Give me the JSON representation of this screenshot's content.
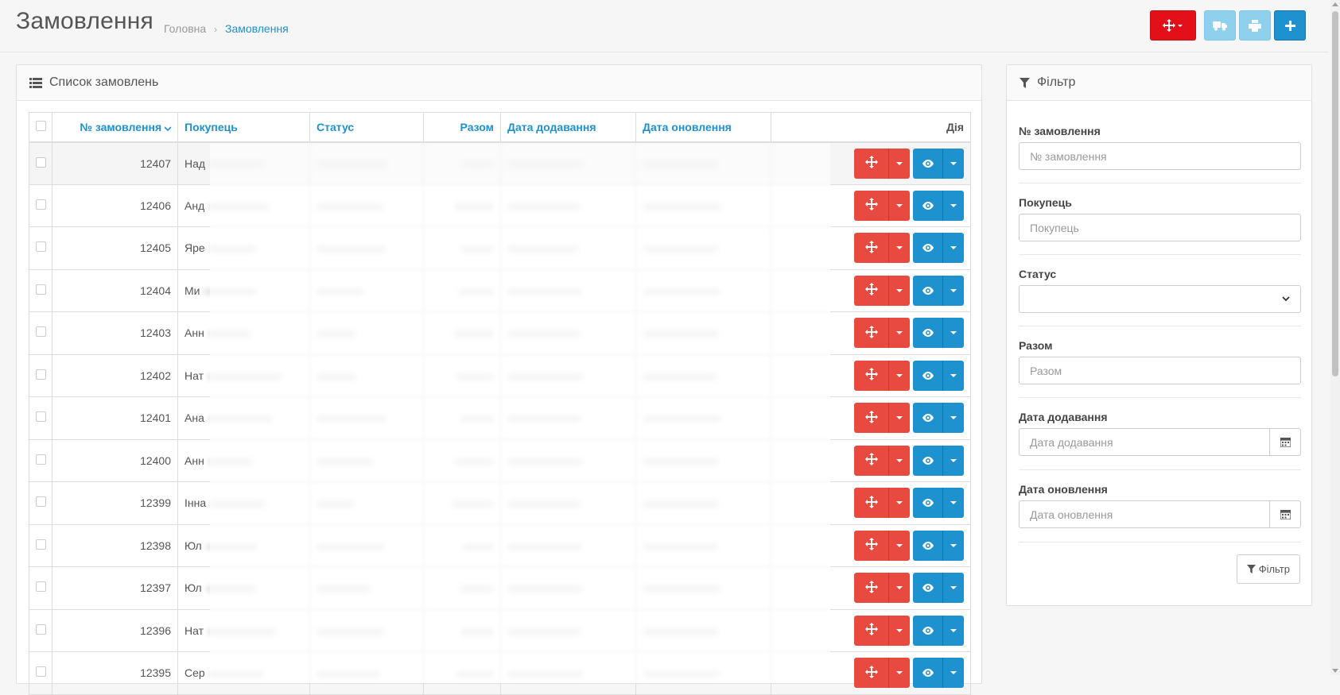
{
  "header": {
    "title": "Замовлення",
    "breadcrumb": [
      {
        "label": "Головна"
      },
      {
        "label": "Замовлення"
      }
    ],
    "buttons": [
      {
        "icon": "arrows-move-icon",
        "color": "#e3101a"
      },
      {
        "icon": "truck-icon",
        "color": "#8fd1ec"
      },
      {
        "icon": "print-icon",
        "color": "#8fd1ec"
      },
      {
        "icon": "plus-icon",
        "color": "#1e91cf"
      }
    ]
  },
  "orders_panel": {
    "title": "Список замовлень",
    "columns": {
      "order_id": "№ замовлення",
      "customer": "Покупець",
      "status": "Статус",
      "total": "Разом",
      "date_added": "Дата додавання",
      "date_modified": "Дата оновлення",
      "action": "Дія"
    },
    "rows": [
      {
        "order_id": "12407",
        "customer": "Над"
      },
      {
        "order_id": "12406",
        "customer": "Анд"
      },
      {
        "order_id": "12405",
        "customer": "Яре"
      },
      {
        "order_id": "12404",
        "customer": "Ми"
      },
      {
        "order_id": "12403",
        "customer": "Анн"
      },
      {
        "order_id": "12402",
        "customer": "Нат"
      },
      {
        "order_id": "12401",
        "customer": "Ана"
      },
      {
        "order_id": "12400",
        "customer": "Анн"
      },
      {
        "order_id": "12399",
        "customer": "Інна"
      },
      {
        "order_id": "12398",
        "customer": "Юл"
      },
      {
        "order_id": "12397",
        "customer": "Юл"
      },
      {
        "order_id": "12396",
        "customer": "Нат"
      },
      {
        "order_id": "12395",
        "customer": "Сер"
      }
    ]
  },
  "filter_panel": {
    "title": "Фільтр",
    "order_id": {
      "label": "№ замовлення",
      "placeholder": "№ замовлення"
    },
    "customer": {
      "label": "Покупець",
      "placeholder": "Покупець"
    },
    "status": {
      "label": "Статус",
      "value": ""
    },
    "total": {
      "label": "Разом",
      "placeholder": "Разом"
    },
    "date_added": {
      "label": "Дата додавання",
      "placeholder": "Дата додавання"
    },
    "date_modified": {
      "label": "Дата оновлення",
      "placeholder": "Дата оновлення"
    },
    "button": "Фільтр"
  },
  "colors": {
    "accent": "#1e91cf",
    "danger": "#e84a3f",
    "header_danger": "#e3101a"
  }
}
